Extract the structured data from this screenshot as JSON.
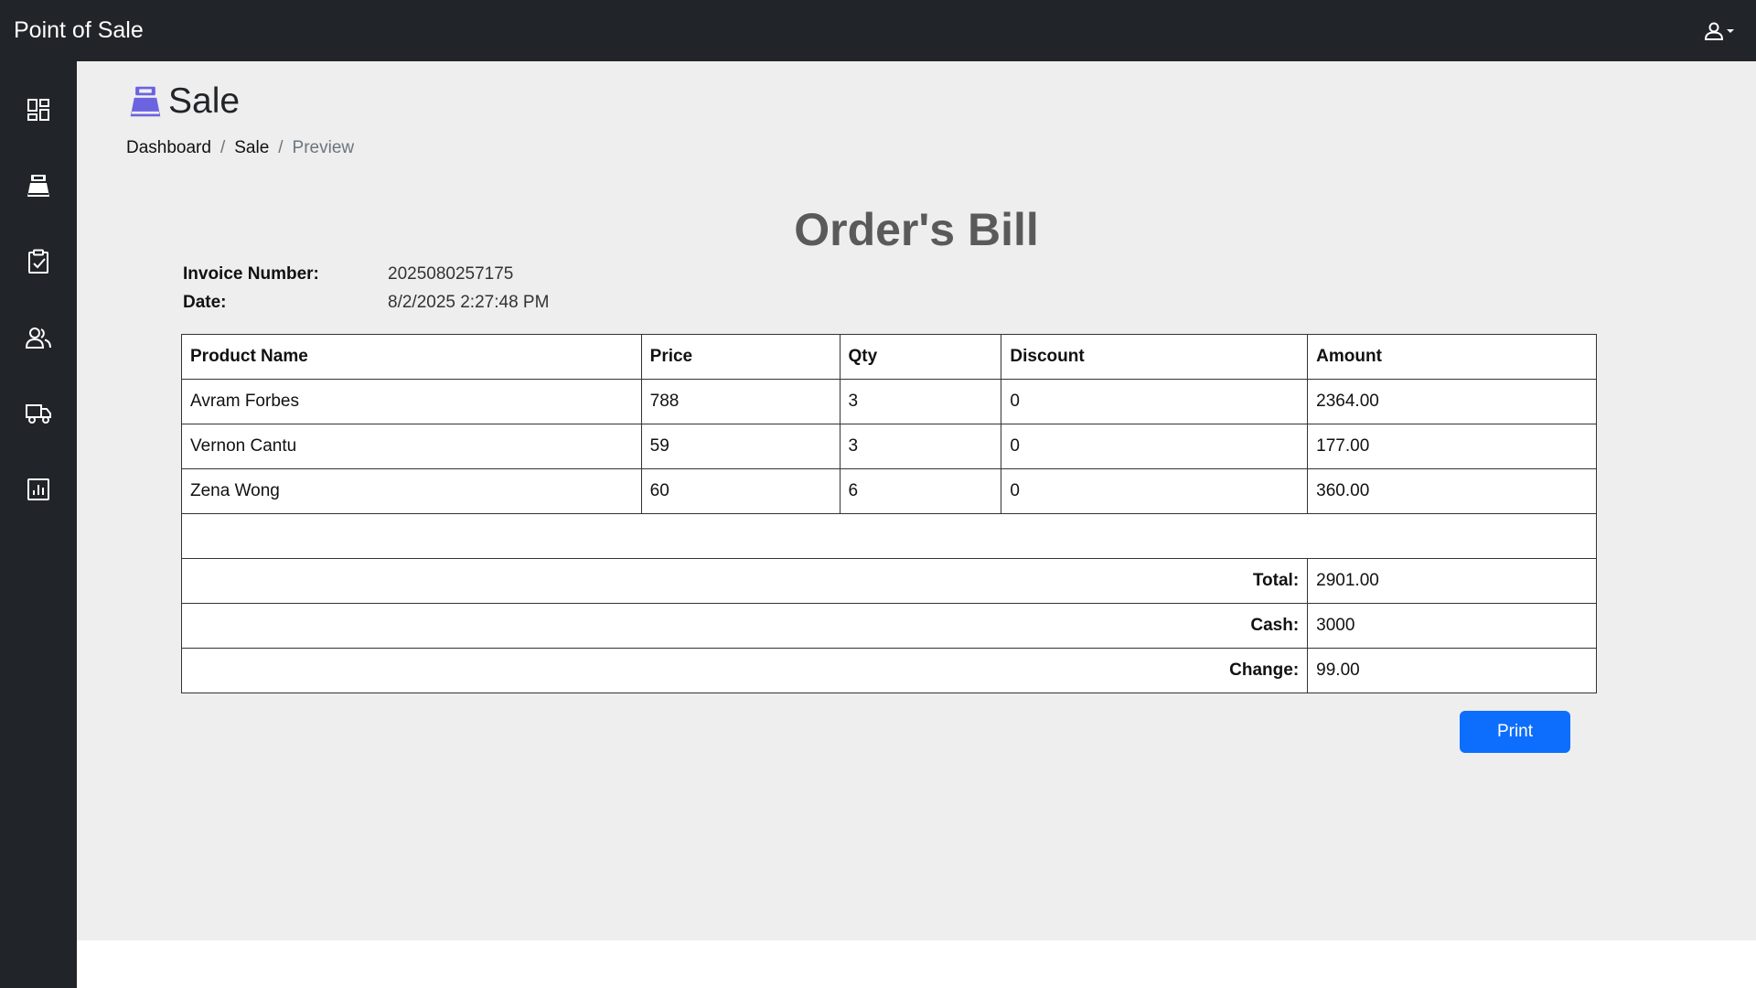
{
  "app": {
    "brand": "Point of Sale"
  },
  "topbar": {
    "user_icon": "user-icon",
    "caret_icon": "chevron-down-icon"
  },
  "sidebar": {
    "items": [
      {
        "icon": "dashboard-icon"
      },
      {
        "icon": "cash-register-icon"
      },
      {
        "icon": "clipboard-check-icon"
      },
      {
        "icon": "people-icon"
      },
      {
        "icon": "truck-icon"
      },
      {
        "icon": "bar-chart-icon"
      }
    ]
  },
  "page": {
    "title": "Sale",
    "title_icon": "cash-register-icon",
    "icon_color": "#6c63e0",
    "breadcrumb": {
      "home": "Dashboard",
      "parent": "Sale",
      "current": "Preview",
      "separator": "/"
    }
  },
  "bill": {
    "title": "Order's Bill",
    "invoice_label": "Invoice Number:",
    "invoice_number": "2025080257175",
    "date_label": "Date:",
    "date": "8/2/2025 2:27:48 PM",
    "columns": [
      "Product Name",
      "Price",
      "Qty",
      "Discount",
      "Amount"
    ],
    "rows": [
      [
        "Avram Forbes",
        "788",
        "3",
        "0",
        "2364.00"
      ],
      [
        "Vernon Cantu",
        "59",
        "3",
        "0",
        "177.00"
      ],
      [
        "Zena Wong",
        "60",
        "6",
        "0",
        "360.00"
      ]
    ],
    "total_label": "Total:",
    "total": "2901.00",
    "cash_label": "Cash:",
    "cash": "3000",
    "change_label": "Change:",
    "change": "99.00"
  },
  "actions": {
    "print_label": "Print",
    "accent_color": "#0d6efd"
  }
}
